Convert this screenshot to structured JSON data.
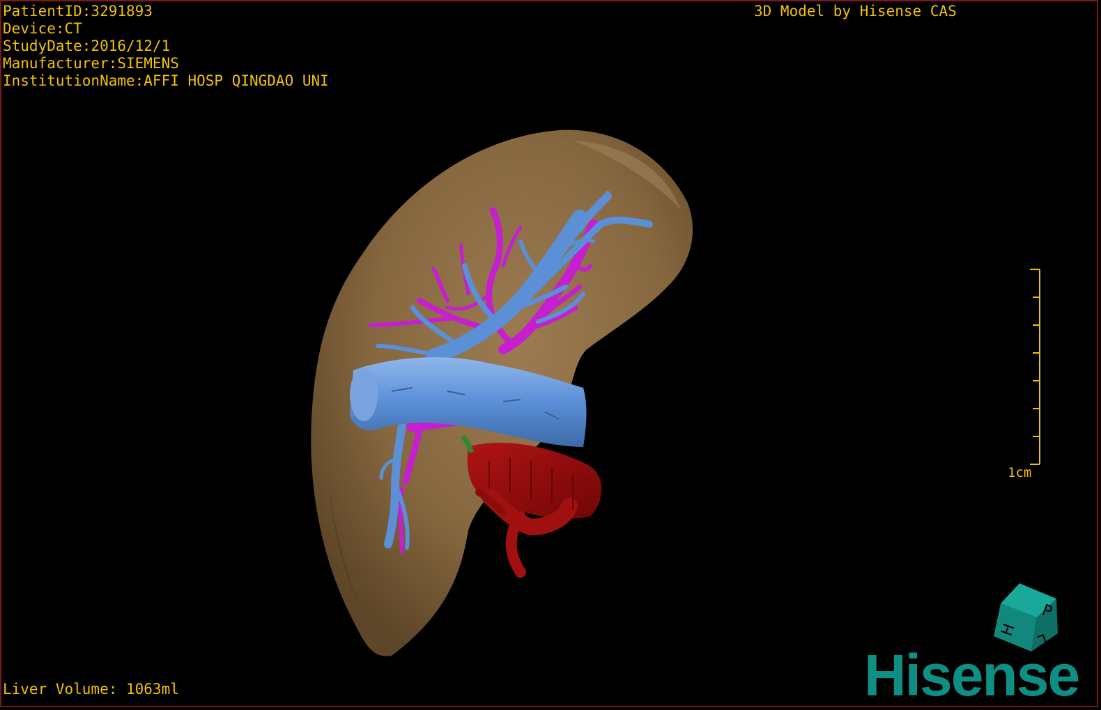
{
  "overlay": {
    "patient_id": "PatientID:3291893",
    "device": "Device:CT",
    "study_date": "StudyDate:2016/12/1",
    "manufacturer": "Manufacturer:SIEMENS",
    "institution": "InstitutionName:AFFI HOSP QINGDAO UNI",
    "credit": "3D Model by Hisense CAS",
    "liver_volume": "Liver Volume: 1063ml"
  },
  "scale_bar": {
    "label": "1cm"
  },
  "orientation_cube": {
    "face_labels": [
      "P",
      "H",
      "L"
    ]
  },
  "logo": {
    "text": "Hisense"
  },
  "colors": {
    "overlay_text": "#f2c200",
    "liver": "#8a6c47",
    "portal_vein": "#5b8fd6",
    "hepatic_artery": "#c51fd0",
    "vena_cava": "#9a0b0b",
    "brand": "#0f8f83"
  }
}
